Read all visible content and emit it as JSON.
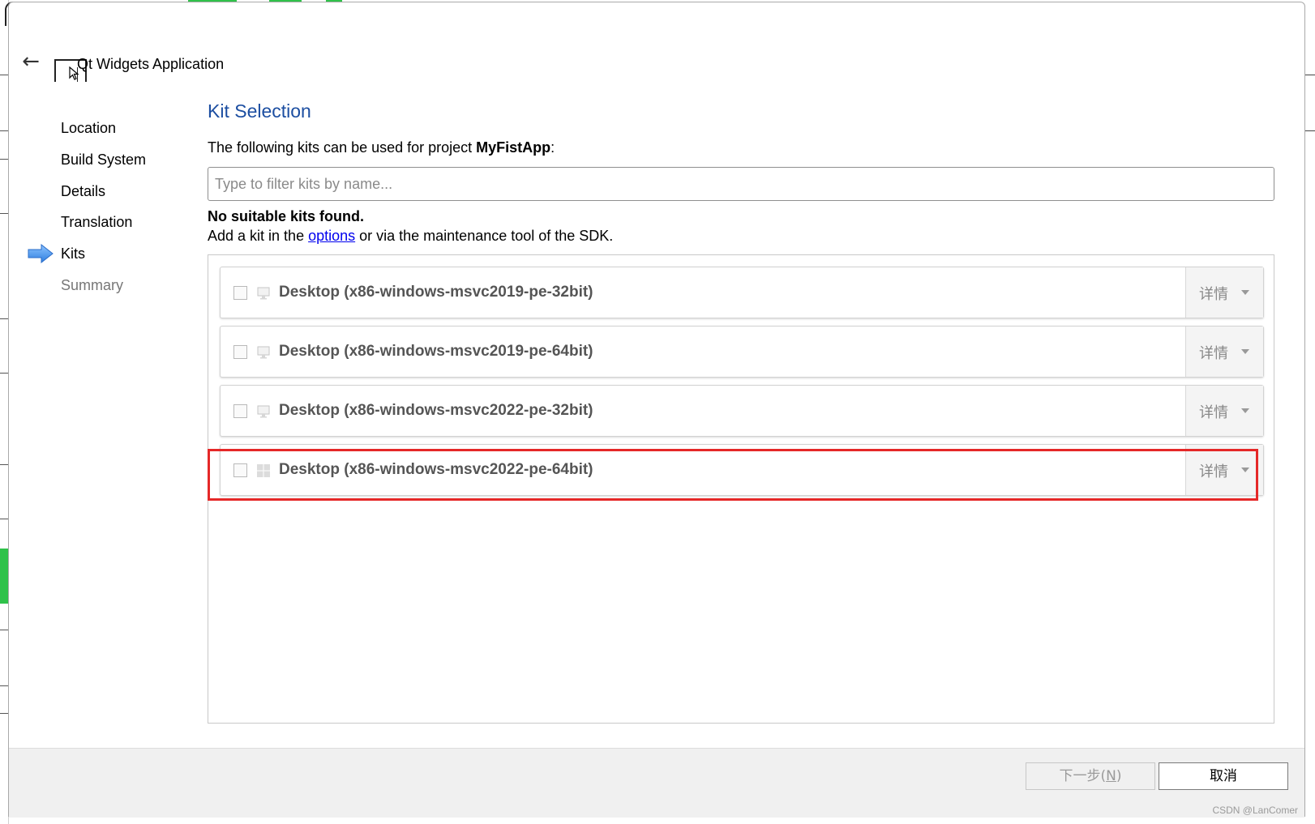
{
  "window": {
    "title": "Qt Widgets Application",
    "back_icon": "arrow-left-icon",
    "app_icon": "window-icon",
    "cursor_icon": "mouse-pointer-icon"
  },
  "steps": [
    {
      "label": "Location",
      "state": "done"
    },
    {
      "label": "Build System",
      "state": "done"
    },
    {
      "label": "Details",
      "state": "done"
    },
    {
      "label": "Translation",
      "state": "done"
    },
    {
      "label": "Kits",
      "state": "current"
    },
    {
      "label": "Summary",
      "state": "pending"
    }
  ],
  "page": {
    "title": "Kit Selection",
    "intro_prefix": "The following kits can be used for project ",
    "project_name": "MyFistApp",
    "intro_suffix": ":",
    "filter_placeholder": "Type to filter kits by name...",
    "no_kits": "No suitable kits found.",
    "add_kit_prefix": "Add a kit in the ",
    "add_kit_link": "options",
    "add_kit_suffix": " or via the maintenance tool of the SDK."
  },
  "kits": [
    {
      "label": "Desktop (x86-windows-msvc2019-pe-32bit)",
      "details": "详情",
      "icon": "monitor-icon",
      "checked": false
    },
    {
      "label": "Desktop (x86-windows-msvc2019-pe-64bit)",
      "details": "详情",
      "icon": "monitor-icon",
      "checked": false
    },
    {
      "label": "Desktop (x86-windows-msvc2022-pe-32bit)",
      "details": "详情",
      "icon": "monitor-icon",
      "checked": false
    },
    {
      "label": "Desktop (x86-windows-msvc2022-pe-64bit)",
      "details": "详情",
      "icon": "windows-logo-icon",
      "checked": false,
      "highlighted": true
    }
  ],
  "footer": {
    "next_prefix": "下一步(",
    "next_key": "N",
    "next_suffix": ")",
    "cancel_label": "取消"
  },
  "watermark": "CSDN @LanComer",
  "colors": {
    "accent_title": "#1c4ea1",
    "highlight": "#e52828",
    "step_arrow": "#3b8ee8"
  }
}
